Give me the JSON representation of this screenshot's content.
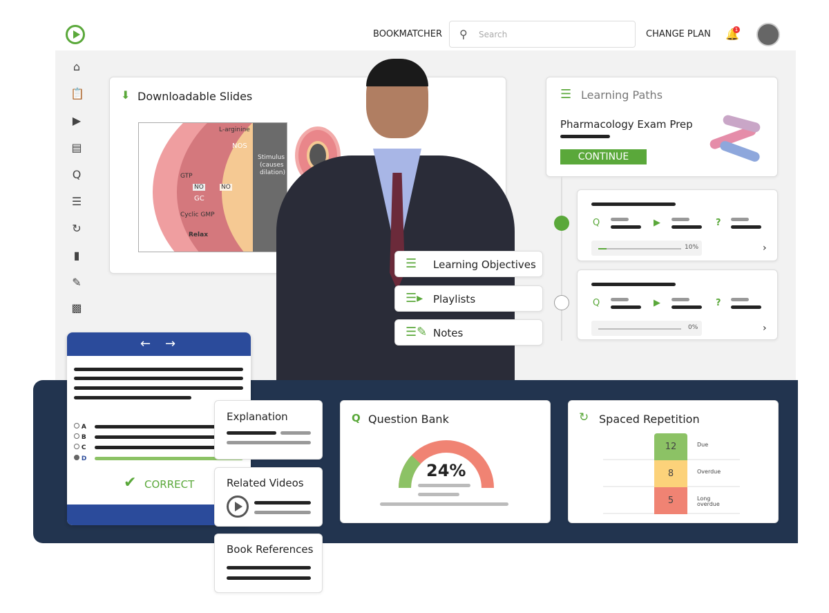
{
  "header": {
    "nav_bookmatcher": "BOOKMATCHER",
    "search_placeholder": "Search",
    "change_plan": "CHANGE PLAN",
    "notification_count": "1"
  },
  "sidebar": {
    "icons": [
      "home-icon",
      "clipboard-icon",
      "video-icon",
      "book-icon",
      "question-icon",
      "list-icon",
      "repeat-icon",
      "bookmark-icon",
      "notes-icon",
      "chart-icon"
    ]
  },
  "slides": {
    "title": "Downloadable Slides",
    "labels": {
      "l_arginine": "L-arginine",
      "nos": "NOS",
      "stimulus": "Stimulus",
      "causes": "(causes",
      "dilation": "dilation)",
      "gtp": "GTP",
      "no1": "NO",
      "no2": "NO",
      "gc": "GC",
      "cgmp": "Cyclic GMP",
      "relax": "Relax"
    }
  },
  "menu": {
    "objectives": "Learning Objectives",
    "playlists": "Playlists",
    "notes": "Notes"
  },
  "learning_paths": {
    "title": "Learning Paths",
    "course": "Pharmacology Exam Prep",
    "continue": "CONTINUE",
    "items": [
      {
        "progress": "10%",
        "value": 10,
        "done": true
      },
      {
        "progress": "0%",
        "value": 0,
        "done": false
      }
    ]
  },
  "quiz": {
    "options": [
      "A",
      "B",
      "C",
      "D"
    ],
    "selected": "D",
    "result": "CORRECT"
  },
  "explanation": {
    "title": "Explanation"
  },
  "related_videos": {
    "title": "Related Videos"
  },
  "book_refs": {
    "title": "Book References"
  },
  "question_bank": {
    "title": "Question Bank",
    "percent": "24%",
    "value": 24
  },
  "spaced_repetition": {
    "title": "Spaced Repetition",
    "rows": [
      {
        "count": "12",
        "label": "Due",
        "color": "#8cc265"
      },
      {
        "count": "8",
        "label": "Overdue",
        "color": "#fcd27a"
      },
      {
        "count": "5",
        "label": "Long overdue",
        "color": "#f08373"
      }
    ]
  },
  "colors": {
    "accent": "#5aa83a",
    "navy": "#22344f",
    "blue": "#2b4b9b"
  }
}
